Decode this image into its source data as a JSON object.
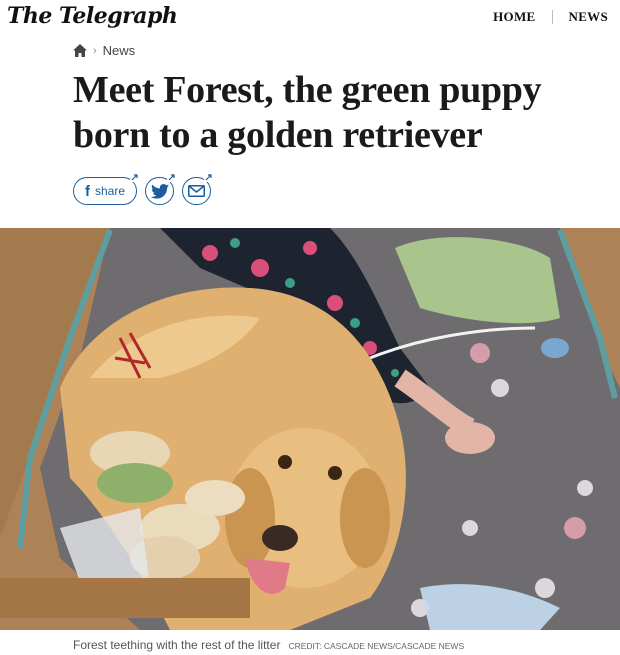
{
  "masthead": {
    "logo": "The Telegraph",
    "nav": [
      "HOME",
      "NEWS"
    ]
  },
  "breadcrumb": {
    "home_icon": "home-icon",
    "section": "News"
  },
  "article": {
    "headline_line1": "Meet Forest, the green puppy",
    "headline_line2": "born to a golden retriever"
  },
  "share": {
    "facebook_label": "share",
    "icons": [
      "facebook-icon",
      "twitter-icon",
      "email-icon"
    ]
  },
  "photo": {
    "caption": "Forest teething with the rest of the litter",
    "credit": "CREDIT: CASCADE NEWS/CASCADE NEWS"
  },
  "colors": {
    "share_blue": "#1b5e9b",
    "text": "#1a1a1a"
  }
}
